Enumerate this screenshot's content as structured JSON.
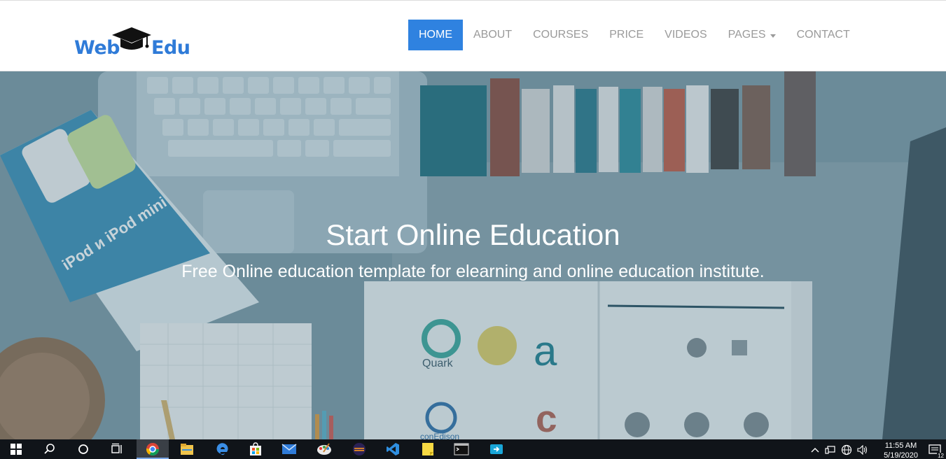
{
  "logo": {
    "word_left": "Web",
    "word_right": "Edu"
  },
  "nav": {
    "items": [
      {
        "label": "HOME",
        "active": true
      },
      {
        "label": "ABOUT",
        "active": false
      },
      {
        "label": "COURSES",
        "active": false
      },
      {
        "label": "PRICE",
        "active": false
      },
      {
        "label": "VIDEOS",
        "active": false
      },
      {
        "label": "PAGES",
        "active": false,
        "dropdown": true
      },
      {
        "label": "CONTACT",
        "active": false
      }
    ]
  },
  "hero": {
    "title": "Start Online Education",
    "subtitle": "Free Online education template for elearning and online education institute.",
    "background_labels": {
      "book_cover": "iPod и iPod mini",
      "logo_quark": "Quark",
      "logo_conedison": "conEdison"
    }
  },
  "taskbar": {
    "time": "11:55 AM",
    "date": "5/19/2020",
    "notification_count": "12",
    "apps": [
      "windows-start-icon",
      "search-icon",
      "cortana-icon",
      "task-view-icon",
      "chrome-icon",
      "file-explorer-icon",
      "edge-icon",
      "store-icon",
      "mail-icon",
      "paint-icon",
      "eclipse-icon",
      "vscode-icon",
      "sticky-notes-icon",
      "terminal-icon",
      "app-icon"
    ]
  },
  "colors": {
    "brand_blue": "#2f7bd8",
    "nav_active_bg": "#2f82e0",
    "nav_text": "#9a9a9a",
    "taskbar_bg": "#101419"
  }
}
